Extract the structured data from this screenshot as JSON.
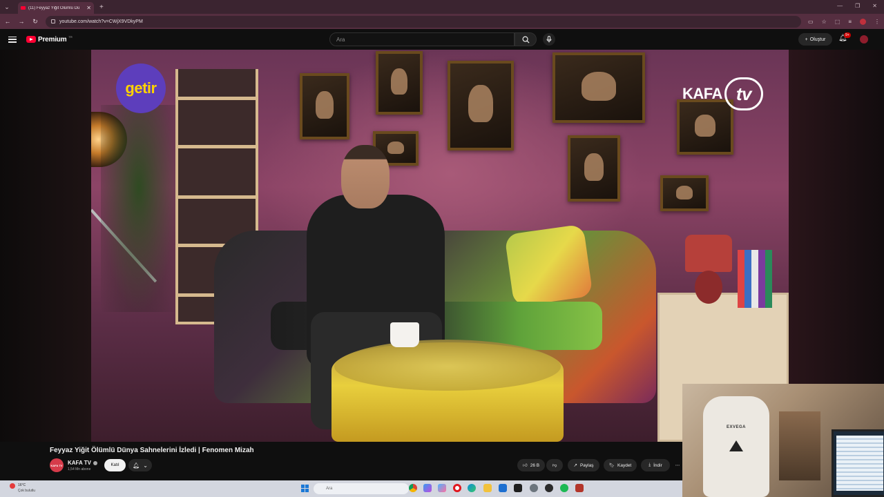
{
  "browser": {
    "tab_title": "(11) Feyyaz Yiğit Ölümlü Dü",
    "url": "youtube.com/watch?v=CWjX9VDkyPM",
    "new_tab_label": "+"
  },
  "youtube": {
    "logo_text": "Premium",
    "logo_region": "TR",
    "search_placeholder": "Ara",
    "create_label": "Oluştur",
    "notification_count": "9+"
  },
  "video": {
    "title": "Feyyaz Yiğit Ölümlü Dünya Sahnelerini İzledi | Fenomen Mizah",
    "overlay_sponsor": "getir",
    "overlay_brand": "KAFA",
    "overlay_brand_tv": "tv",
    "webcam_chair_brand": "EXVEGA"
  },
  "channel": {
    "avatar_text": "KAFA TV",
    "name": "KAFA TV",
    "subscribers": "1,54 Mn abone",
    "join_label": "Katıl"
  },
  "actions": {
    "like_count": "26 B",
    "share_label": "Paylaş",
    "save_label": "Kaydet",
    "download_label": "İndir"
  },
  "taskbar": {
    "weather_temp": "16°C",
    "weather_desc": "Çok bulutlu",
    "search_placeholder": "Ara"
  },
  "colors": {
    "youtube_red": "#ff0033",
    "browser_frame": "#552e40",
    "page_bg": "#0f0f0f"
  }
}
